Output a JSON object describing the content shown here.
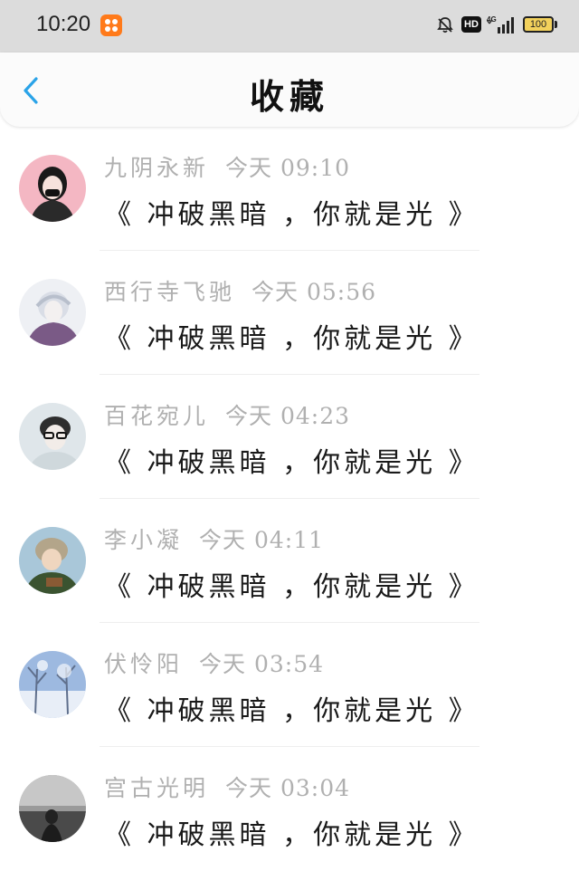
{
  "status_bar": {
    "time": "10:20",
    "network": "4G",
    "hd": "HD",
    "battery": "100",
    "icons": [
      "app-badge-icon",
      "mute-bell-icon",
      "hd-icon",
      "signal-icon",
      "battery-icon"
    ]
  },
  "header": {
    "title": "收藏",
    "back_icon": "chevron-left-icon",
    "accent": "#2aa3e8"
  },
  "items": [
    {
      "name": "九阴永新",
      "time": "今天 09:10",
      "title": "《 冲破黑暗 ，你就是光 》",
      "avatar": "avatar-icon"
    },
    {
      "name": "西行寺飞驰",
      "time": "今天 05:56",
      "title": "《 冲破黑暗 ，你就是光 》",
      "avatar": "avatar-icon"
    },
    {
      "name": "百花宛儿",
      "time": "今天 04:23",
      "title": "《 冲破黑暗 ，你就是光 》",
      "avatar": "avatar-icon"
    },
    {
      "name": "李小凝",
      "time": "今天 04:11",
      "title": "《 冲破黑暗 ，你就是光 》",
      "avatar": "avatar-icon"
    },
    {
      "name": "伏怜阳",
      "time": "今天 03:54",
      "title": "《 冲破黑暗 ，你就是光 》",
      "avatar": "avatar-icon"
    },
    {
      "name": "宫古光明",
      "time": "今天 03:04",
      "title": "《 冲破黑暗 ，你就是光 》",
      "avatar": "avatar-icon"
    }
  ]
}
